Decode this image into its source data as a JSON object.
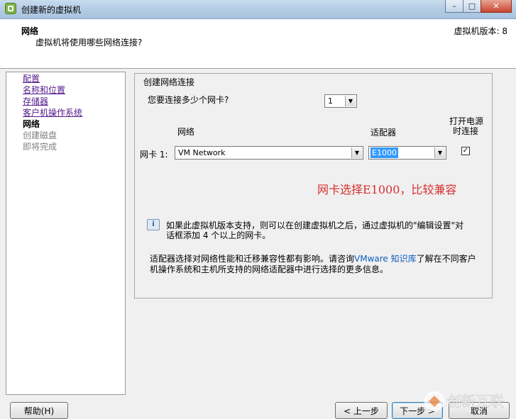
{
  "window": {
    "title": "创建新的虚拟机",
    "minimize": "–",
    "maximize": "□",
    "close": "✕"
  },
  "header": {
    "title": "网络",
    "subtitle": "虚拟机将使用哪些网络连接?",
    "version": "虚拟机版本: 8"
  },
  "sidebar": {
    "items": [
      {
        "label": "配置",
        "state": "link"
      },
      {
        "label": "名称和位置",
        "state": "link"
      },
      {
        "label": "存储器",
        "state": "link"
      },
      {
        "label": "客户机操作系统",
        "state": "link"
      },
      {
        "label": "网络",
        "state": "current"
      },
      {
        "label": "创建磁盘",
        "state": "future"
      },
      {
        "label": "即将完成",
        "state": "future"
      }
    ]
  },
  "main": {
    "group_label": "创建网络连接",
    "nic_count_label": "您要连接多少个网卡?",
    "nic_count_value": "1",
    "col_network": "网络",
    "col_adapter": "适配器",
    "col_power_line1": "打开电源",
    "col_power_line2": "时连接",
    "nic_row_label": "网卡 1:",
    "network_value": "VM Network",
    "adapter_value": "E1000",
    "power_on_checked": true,
    "checkbox_mark": "✓",
    "annotation": "网卡选择E1000，比较兼容",
    "info_text": "如果此虚拟机版本支持，则可以在创建虚拟机之后，通过虚拟机的\"编辑设置\"对话框添加 4 个以上的网卡。",
    "para_before_link": "适配器选择对网络性能和迁移兼容性都有影响。请咨询",
    "para_link": "VMware 知识库",
    "para_after_link": "了解在不同客户机操作系统和主机所支持的网络适配器中进行选择的更多信息。"
  },
  "footer": {
    "help": "帮助(H)",
    "back": "< 上一步",
    "next": "下一步 >",
    "cancel": "取消"
  },
  "watermark": {
    "text": "创新互联"
  }
}
